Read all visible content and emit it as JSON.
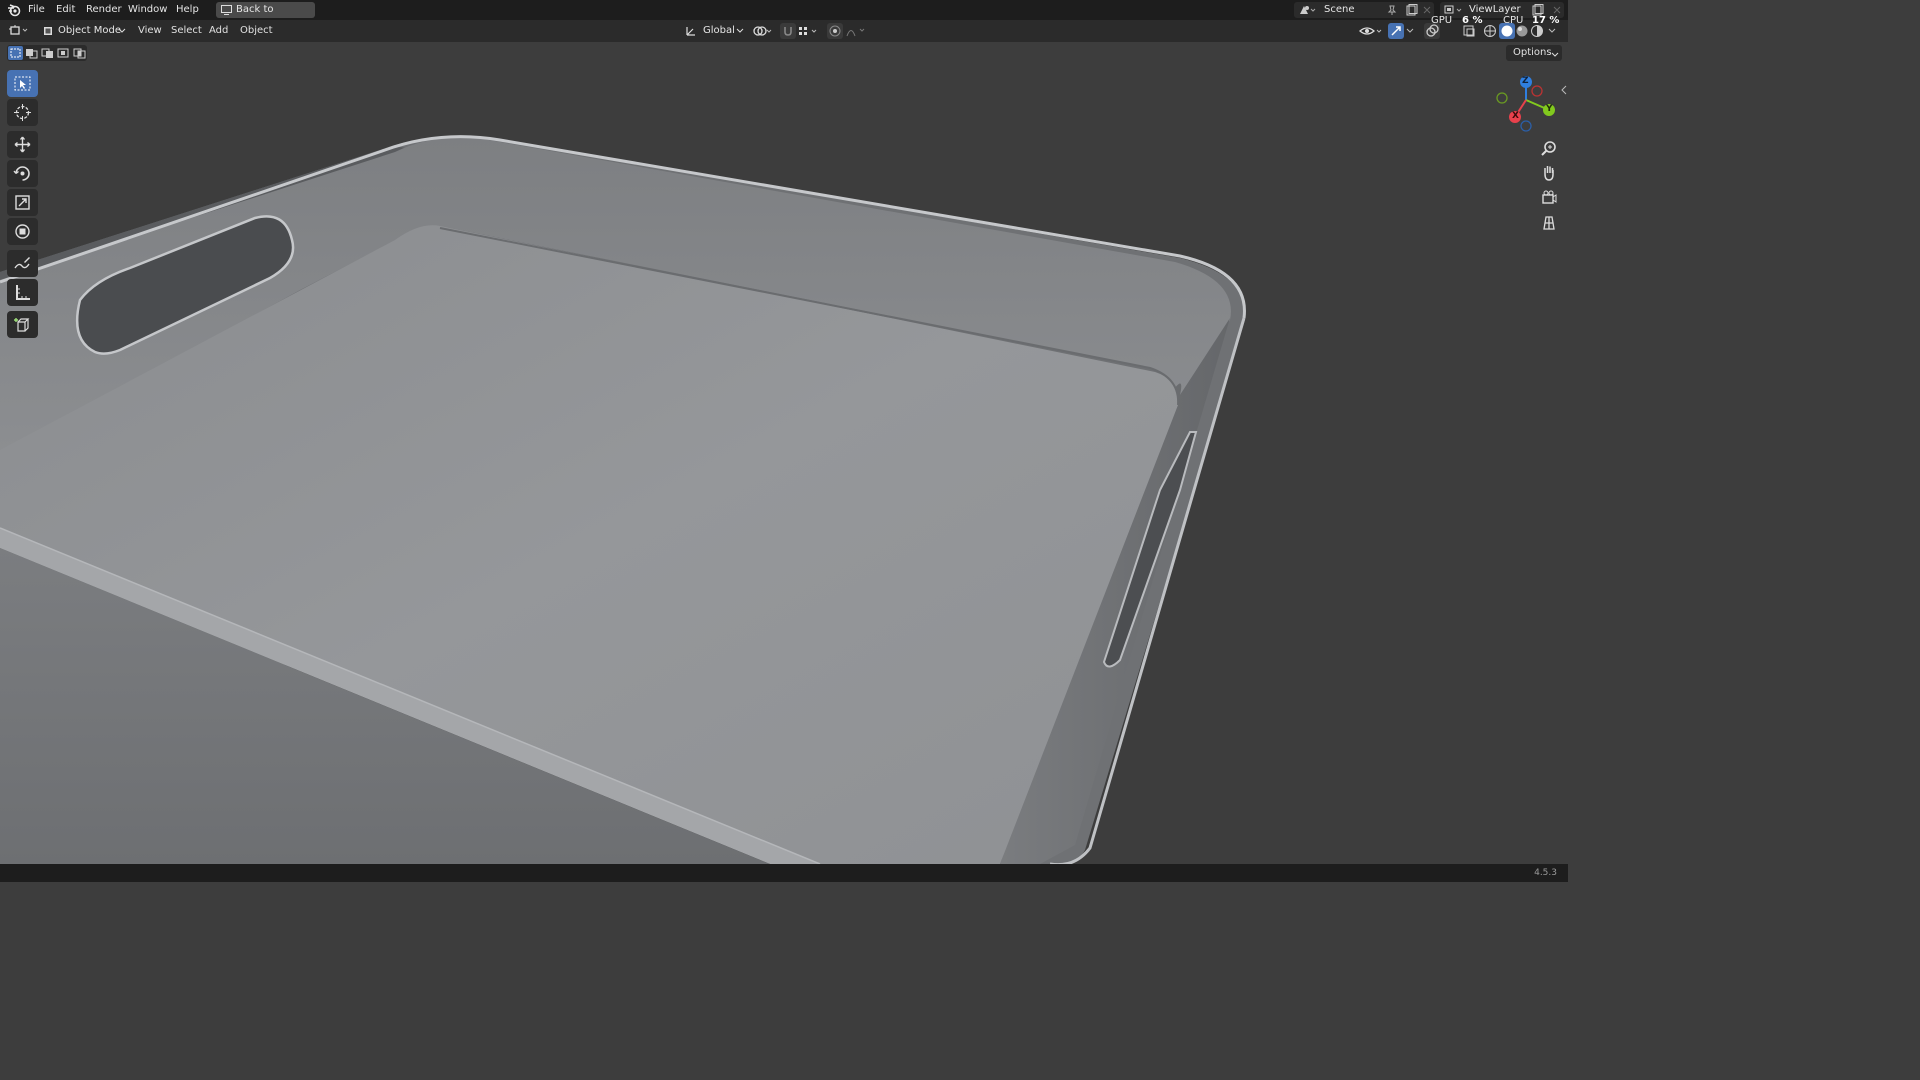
{
  "menubar": {
    "items": [
      "File",
      "Edit",
      "Render",
      "Window",
      "Help"
    ],
    "back_button": "Back to Previous",
    "scene_name": "Scene",
    "view_layer": "ViewLayer"
  },
  "stats": {
    "gpu_label": "GPU",
    "gpu_value": "6 %",
    "cpu_label": "CPU",
    "cpu_value": "17 %"
  },
  "header": {
    "mode": "Object Mode",
    "menus": [
      "View",
      "Select",
      "Add",
      "Object"
    ],
    "transform_orientation": "Global"
  },
  "viewport": {
    "options_label": "Options",
    "gizmo": {
      "z": "Z",
      "y": "Y",
      "x": "X"
    }
  },
  "toolbar": {
    "tools": [
      "select-box-icon",
      "cursor-icon",
      "move-icon",
      "rotate-icon",
      "scale-icon",
      "transform-icon",
      "annotate-icon",
      "measure-icon",
      "add-cube-icon"
    ],
    "active_tool": "select-box-icon"
  },
  "statusbar": {
    "version": "4.5.3"
  },
  "colors": {
    "accent": "#4772b3",
    "topbar": "#1d1d1d",
    "viewport_bg": "#3d3d3d",
    "axis_x": "#e8414c",
    "axis_y": "#82c91e",
    "axis_z": "#2f7fe0"
  }
}
